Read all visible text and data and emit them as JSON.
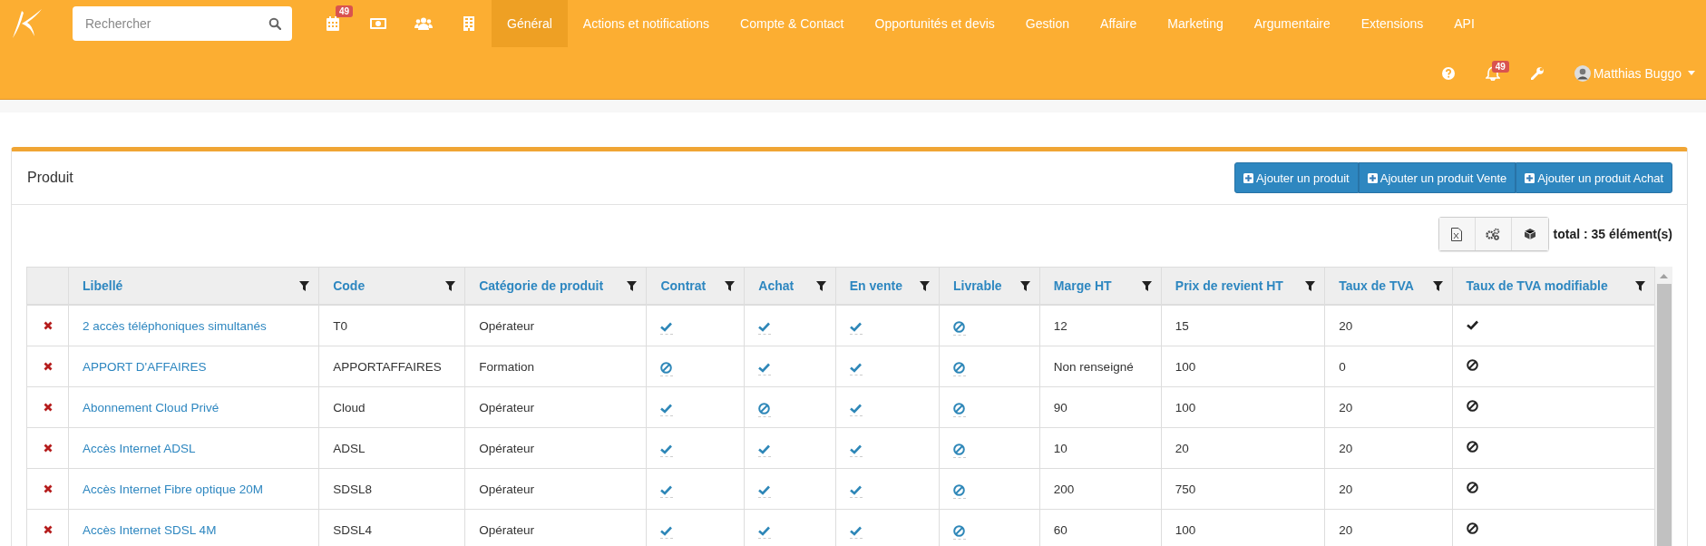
{
  "search": {
    "placeholder": "Rechercher"
  },
  "quick_icons": [
    {
      "kind": "calendar",
      "badge": "49"
    },
    {
      "kind": "money"
    },
    {
      "kind": "users"
    },
    {
      "kind": "building"
    }
  ],
  "nav": [
    {
      "label": "Général",
      "selected": true
    },
    {
      "label": "Actions et notifications",
      "selected": false
    },
    {
      "label": "Compte & Contact",
      "selected": false
    },
    {
      "label": "Opportunités et devis",
      "selected": false
    },
    {
      "label": "Gestion",
      "selected": false
    },
    {
      "label": "Affaire",
      "selected": false
    },
    {
      "label": "Marketing",
      "selected": false
    },
    {
      "label": "Argumentaire",
      "selected": false
    },
    {
      "label": "Extensions",
      "selected": false
    },
    {
      "label": "API",
      "selected": false
    }
  ],
  "user_bar": {
    "notifications_badge": "49",
    "user_name": "Matthias Buggo"
  },
  "panel": {
    "title": "Produit",
    "buttons": [
      "Ajouter un produit",
      "Ajouter un produit Vente",
      "Ajouter un produit Achat"
    ],
    "total": "total : 35 élément(s)"
  },
  "table": {
    "columns": [
      "Libellé",
      "Code",
      "Catégorie de produit",
      "Contrat",
      "Achat",
      "En vente",
      "Livrable",
      "Marge HT",
      "Prix de revient HT",
      "Taux de TVA",
      "Taux de TVA modifiable"
    ],
    "rows": [
      {
        "libelle": "2 accès téléphoniques simultanés",
        "code": "T0",
        "categorie": "Opérateur",
        "contrat": true,
        "achat": true,
        "en_vente": true,
        "livrable": false,
        "marge": "12",
        "prix": "15",
        "tva": "20",
        "tva_modifiable": true
      },
      {
        "libelle": "APPORT D'AFFAIRES",
        "code": "APPORTAFFAIRES",
        "categorie": "Formation",
        "contrat": false,
        "achat": true,
        "en_vente": true,
        "livrable": false,
        "marge": "Non renseigné",
        "prix": "100",
        "tva": "0",
        "tva_modifiable": false
      },
      {
        "libelle": "Abonnement Cloud Privé",
        "code": "Cloud",
        "categorie": "Opérateur",
        "contrat": true,
        "achat": false,
        "en_vente": true,
        "livrable": false,
        "marge": "90",
        "prix": "100",
        "tva": "20",
        "tva_modifiable": false
      },
      {
        "libelle": "Accès Internet ADSL",
        "code": "ADSL",
        "categorie": "Opérateur",
        "contrat": true,
        "achat": true,
        "en_vente": true,
        "livrable": false,
        "marge": "10",
        "prix": "20",
        "tva": "20",
        "tva_modifiable": false
      },
      {
        "libelle": "Accès Internet Fibre optique 20M",
        "code": "SDSL8",
        "categorie": "Opérateur",
        "contrat": true,
        "achat": true,
        "en_vente": true,
        "livrable": false,
        "marge": "200",
        "prix": "750",
        "tva": "20",
        "tva_modifiable": false
      },
      {
        "libelle": "Accès Internet SDSL 4M",
        "code": "SDSL4",
        "categorie": "Opérateur",
        "contrat": true,
        "achat": true,
        "en_vente": true,
        "livrable": false,
        "marge": "60",
        "prix": "100",
        "tva": "20",
        "tva_modifiable": false
      }
    ]
  }
}
